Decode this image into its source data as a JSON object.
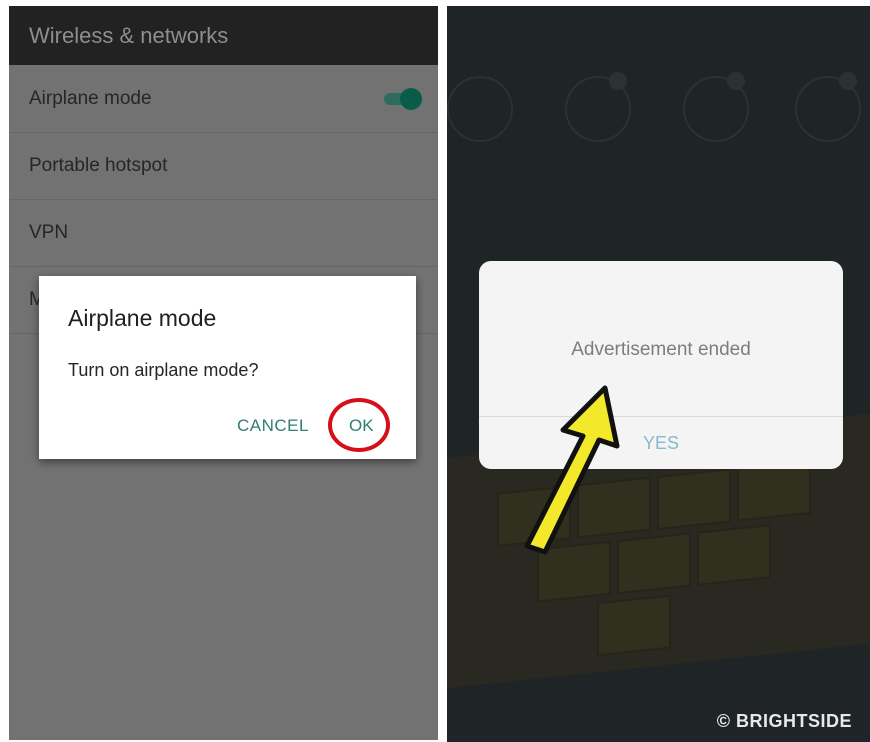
{
  "left": {
    "header_title": "Wireless & networks",
    "rows": [
      {
        "label": "Airplane mode",
        "toggle_on": true
      },
      {
        "label": "Portable hotspot"
      },
      {
        "label": "VPN"
      },
      {
        "label": "M"
      }
    ],
    "dialog": {
      "title": "Airplane mode",
      "message": "Turn on airplane mode?",
      "cancel_label": "CANCEL",
      "ok_label": "OK"
    },
    "colors": {
      "accent": "#2f7d75",
      "highlight_ring": "#d5101b"
    }
  },
  "right": {
    "dialog": {
      "message": "Advertisement ended",
      "yes_label": "YES"
    },
    "watermark": "© BRIGHTSIDE",
    "colors": {
      "arrow": "#f4e82a",
      "yes": "#8ab8cc"
    }
  }
}
